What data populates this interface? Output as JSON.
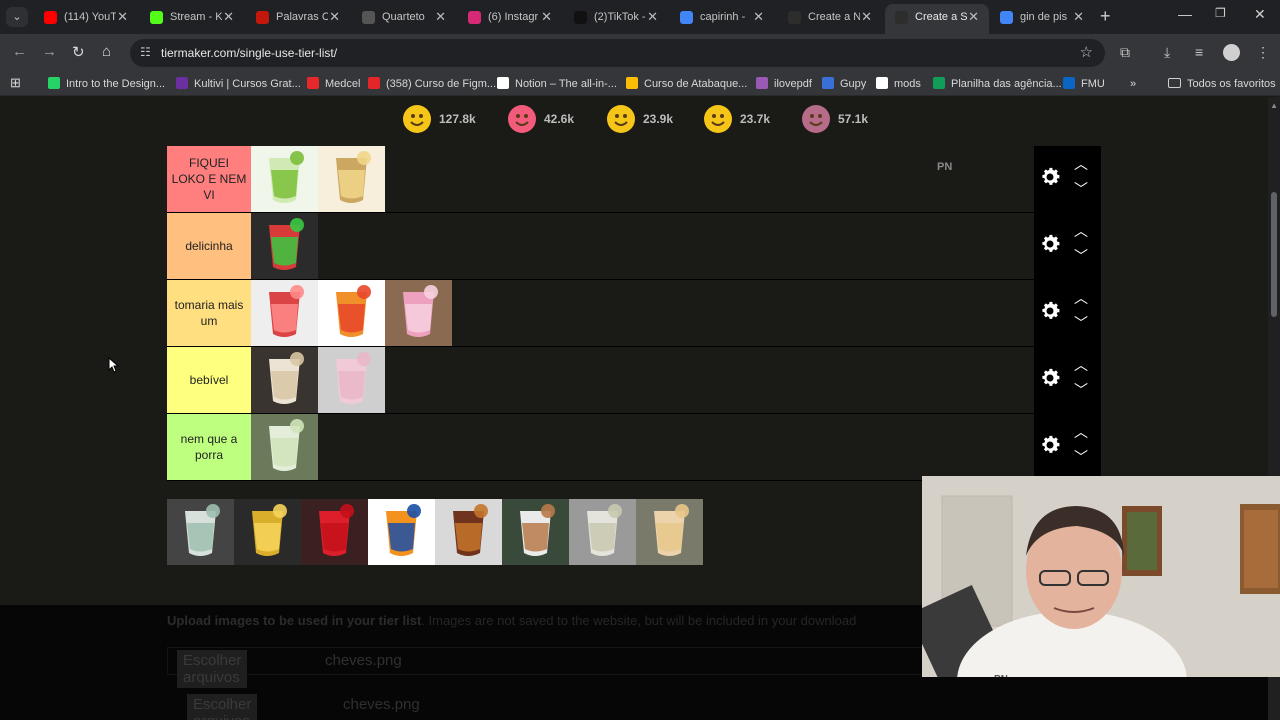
{
  "browser": {
    "tabs": [
      {
        "title": "(114) YouT",
        "icon": "youtube-icon",
        "color": "#ff0000"
      },
      {
        "title": "Stream - K",
        "icon": "kick-icon",
        "color": "#53fc18"
      },
      {
        "title": "Palavras C",
        "icon": "g1-icon",
        "color": "#c4170c"
      },
      {
        "title": "Quarteto",
        "icon": "t-letter-icon",
        "color": "#555555"
      },
      {
        "title": "(6) Instagr",
        "icon": "instagram-icon",
        "color": "#d62976"
      },
      {
        "title": "(2)TikTok -",
        "icon": "tiktok-icon",
        "color": "#111111"
      },
      {
        "title": "capirinh - ",
        "icon": "google-icon",
        "color": "#4285f4"
      },
      {
        "title": "Create a N",
        "icon": "tiermaker-icon",
        "color": "#2d2d2d"
      },
      {
        "title": "Create a S",
        "icon": "tiermaker-icon",
        "color": "#2d2d2d"
      },
      {
        "title": "gin de pis",
        "icon": "google-icon",
        "color": "#4285f4"
      }
    ],
    "url": "tiermaker.com/single-use-tier-list/",
    "bookmarks": [
      {
        "label": "Intro to the Design...",
        "icon": "whatsapp-icon",
        "color": "#25d366"
      },
      {
        "label": "Kultivi | Cursos Grat...",
        "icon": "kultivi-icon",
        "color": "#6b2fa0"
      },
      {
        "label": "Medcel",
        "icon": "medcel-icon",
        "color": "#e6282d"
      },
      {
        "label": "(358) Curso de Figm...",
        "icon": "adobe-icon",
        "color": "#e4262a"
      },
      {
        "label": "Notion – The all-in-...",
        "icon": "notion-icon",
        "color": "#ffffff"
      },
      {
        "label": "Curso de Atabaque...",
        "icon": "google-colors-icon",
        "color": "#fbbc05"
      },
      {
        "label": "ilovepdf",
        "icon": "ilovepdf-icon",
        "color": "#9b59b6"
      },
      {
        "label": "Gupy",
        "icon": "gupy-icon",
        "color": "#3a6fd8"
      },
      {
        "label": "mods",
        "icon": "nexus-icon",
        "color": "#ffffff"
      },
      {
        "label": "Planilha das agência...",
        "icon": "sheets-icon",
        "color": "#0f9d58"
      },
      {
        "label": "FMU",
        "icon": "linkedin-icon",
        "color": "#0a66c2"
      }
    ],
    "all_bookmarks": "Todos os favoritos"
  },
  "reactions": [
    {
      "emoji": "grin-emoji",
      "count": "127.8k",
      "color": "#f5c518"
    },
    {
      "emoji": "heart-eyes-emoji",
      "count": "42.6k",
      "color": "#f25b7a"
    },
    {
      "emoji": "laugh-emoji",
      "count": "23.9k",
      "color": "#f5c518"
    },
    {
      "emoji": "raised-hands-emoji",
      "count": "23.7k",
      "color": "#f5c518"
    },
    {
      "emoji": "poop-emoji",
      "count": "57.1k",
      "color": "#b66b88"
    }
  ],
  "tiers": [
    {
      "label": "FIQUEI LOKO E NEM VI",
      "color": "#ff7f7f",
      "items": 2,
      "watermark": "PN"
    },
    {
      "label": "delicinha",
      "color": "#ffbf7f",
      "items": 1
    },
    {
      "label": "tomaria mais um",
      "color": "#ffdf7f",
      "items": 3
    },
    {
      "label": "bebível",
      "color": "#ffff7f",
      "items": 2
    },
    {
      "label": "nem que a porra",
      "color": "#bfff7f",
      "items": 1
    }
  ],
  "upload": {
    "bold": "Upload images to be used in your tier list",
    "rest": ". Images are not saved to the website, but will be included in your download",
    "choose_label": "Escolher arquivos",
    "file_name": "cheves.png",
    "webcam_watermark": "PN"
  }
}
